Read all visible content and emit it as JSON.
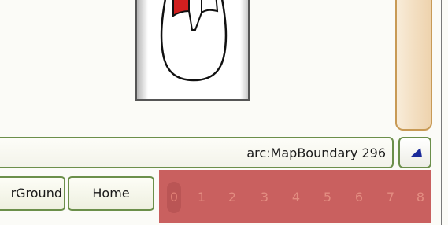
{
  "status": {
    "text": "arc:MapBoundary 296"
  },
  "buttons": {
    "ground_label": "rGround",
    "home_label": "Home"
  },
  "arrow_button": {
    "icon": "triangle-left-icon",
    "color": "#1a2a9a"
  },
  "layers": {
    "items": [
      "0",
      "1",
      "2",
      "3",
      "4",
      "5",
      "6",
      "7",
      "8"
    ],
    "selected": "0",
    "strip_color": "#c85b5b"
  },
  "mouse_illustration": {
    "icon": "mouse-icon",
    "highlight_color": "#d11f1f"
  }
}
